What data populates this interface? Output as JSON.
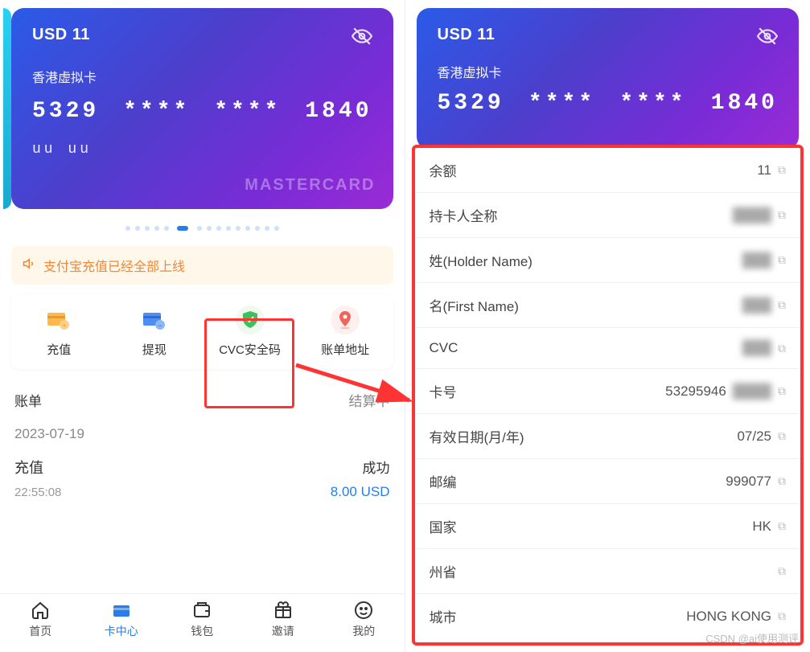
{
  "card": {
    "balance": "USD 11",
    "label": "香港虚拟卡",
    "num1": "5329",
    "num2": "****",
    "num3": "****",
    "num4": "1840",
    "exp": "uu uu",
    "brand": "MASTERCARD"
  },
  "notice": "支付宝充值已经全部上线",
  "actions": {
    "recharge": "充值",
    "withdraw": "提现",
    "cvc": "CVC安全码",
    "billing": "账单地址"
  },
  "tabs": {
    "left": "账单",
    "right": "结算中"
  },
  "history": {
    "date": "2023-07-19",
    "item": {
      "title": "充值",
      "status": "成功",
      "time": "22:55:08",
      "amount": "8.00 USD"
    }
  },
  "nav": {
    "home": "首页",
    "card": "卡中心",
    "wallet": "钱包",
    "invite": "邀请",
    "me": "我的"
  },
  "details": {
    "balance": {
      "label": "余额",
      "value": "11"
    },
    "holder_full": {
      "label": "持卡人全称",
      "value": "████"
    },
    "holder_name": {
      "label": "姓(Holder Name)",
      "value": "███"
    },
    "first_name": {
      "label": "名(First Name)",
      "value": "███"
    },
    "cvc": {
      "label": "CVC",
      "value": "███"
    },
    "card_no": {
      "label": "卡号",
      "value_prefix": "53295946",
      "value_suffix": "████"
    },
    "expiry": {
      "label": "有效日期(月/年)",
      "value": "07/25"
    },
    "zip": {
      "label": "邮编",
      "value": "999077"
    },
    "country": {
      "label": "国家",
      "value": "HK"
    },
    "province": {
      "label": "州省",
      "value": ""
    },
    "city": {
      "label": "城市",
      "value": "HONG KONG"
    }
  },
  "watermark": "CSDN @ai使用测评"
}
